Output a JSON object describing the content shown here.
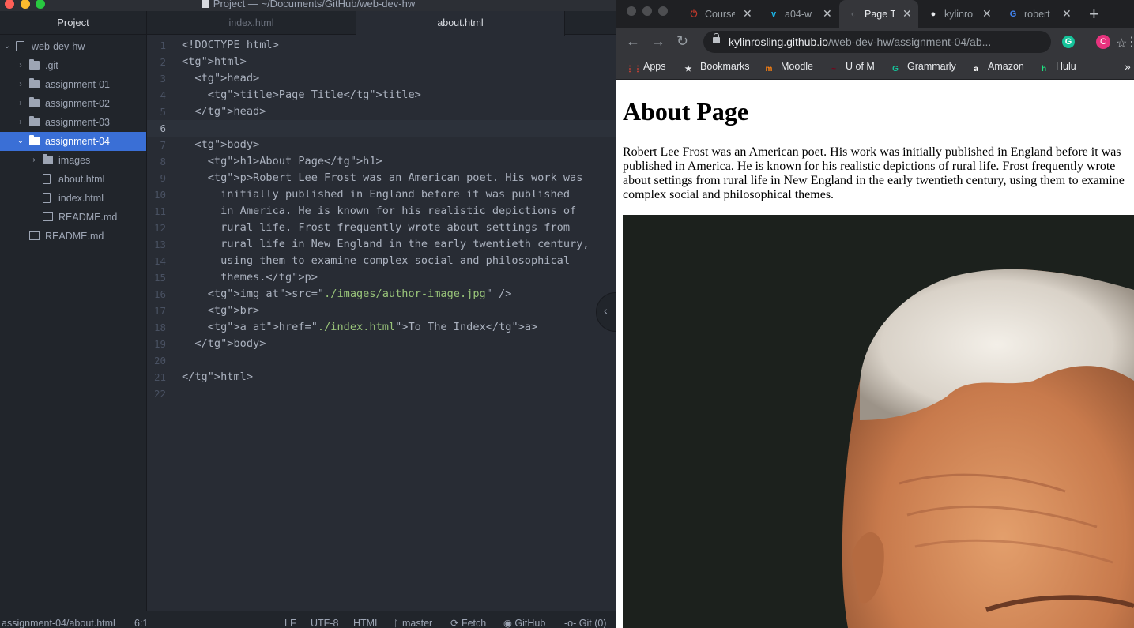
{
  "atom": {
    "window_title": "Project — ~/Documents/GitHub/web-dev-hw",
    "tree": {
      "header": "Project",
      "items": [
        {
          "label": "web-dev-hw",
          "type": "repo",
          "chevron": "⌄"
        },
        {
          "label": ".git",
          "type": "folder",
          "chevron": "›"
        },
        {
          "label": "assignment-01",
          "type": "folder",
          "chevron": "›"
        },
        {
          "label": "assignment-02",
          "type": "folder",
          "chevron": "›"
        },
        {
          "label": "assignment-03",
          "type": "folder",
          "chevron": "›"
        },
        {
          "label": "assignment-04",
          "type": "folder",
          "chevron": "⌄",
          "selected": true
        },
        {
          "label": "images",
          "type": "folder",
          "chevron": "›"
        },
        {
          "label": "about.html",
          "type": "file"
        },
        {
          "label": "index.html",
          "type": "file"
        },
        {
          "label": "README.md",
          "type": "md"
        },
        {
          "label": "README.md",
          "type": "md"
        }
      ]
    },
    "tabs": [
      {
        "label": "index.html"
      },
      {
        "label": "about.html"
      }
    ],
    "code_lines": [
      "<!DOCTYPE html>",
      "<html>",
      "  <head>",
      "    <title>Page Title</title>",
      "  </head>",
      "",
      "  <body>",
      "    <h1>About Page</h1>",
      "    <p>Robert Lee Frost was an American poet. His work was",
      "      initially published in England before it was published",
      "      in America. He is known for his realistic depictions of",
      "      rural life. Frost frequently wrote about settings from",
      "      rural life in New England in the early twentieth century,",
      "      using them to examine complex social and philosophical",
      "      themes.</p>",
      "    <img src=\"./images/author-image.jpg\" />",
      "    <br>",
      "    <a href=\"./index.html\">To The Index</a>",
      "  </body>",
      "",
      "</html>",
      ""
    ],
    "status": {
      "path": "assignment-04/about.html",
      "cursor": "6:1",
      "line_ending": "LF",
      "encoding": "UTF-8",
      "grammar": "HTML",
      "branch": "master",
      "fetch": "Fetch",
      "github": "GitHub",
      "git": "Git (0)"
    }
  },
  "browser": {
    "tabs": [
      {
        "label": "Course",
        "favicon": "⏻",
        "fav_color": "#c0392b"
      },
      {
        "label": "a04-w",
        "favicon": "v",
        "fav_color": "#1ab7ea"
      },
      {
        "label": "Page T",
        "favicon": "◐",
        "fav_color": "#5f6368",
        "active": true
      },
      {
        "label": "kylinro",
        "favicon": "●",
        "fav_color": "#e8eaed"
      },
      {
        "label": "robert",
        "favicon": "G",
        "fav_color": "#4285f4"
      }
    ],
    "url_host": "kylinrosling.github.io",
    "url_path": "/web-dev-hw/assignment-04/ab...",
    "bookmarks": [
      {
        "label": "Apps",
        "icon": "⋮⋮",
        "color": "#ea4335"
      },
      {
        "label": "Bookmarks",
        "icon": "★",
        "color": "#e8eaed"
      },
      {
        "label": "Moodle",
        "icon": "m",
        "color": "#f98012"
      },
      {
        "label": "U of M",
        "icon": "~",
        "color": "#7a0019"
      },
      {
        "label": "Grammarly",
        "icon": "G",
        "color": "#15c39a"
      },
      {
        "label": "Amazon",
        "icon": "a",
        "color": "#ffffff"
      },
      {
        "label": "Hulu",
        "icon": "h",
        "color": "#1ce783"
      }
    ],
    "avatar_letter": "C",
    "page": {
      "heading": "About Page",
      "paragraph": "Robert Lee Frost was an American poet. His work was initially published in England before it was published in America. He is known for his realistic depictions of rural life. Frost frequently wrote about settings from rural life in New England in the early twentieth century, using them to examine complex social and philosophical themes."
    }
  }
}
